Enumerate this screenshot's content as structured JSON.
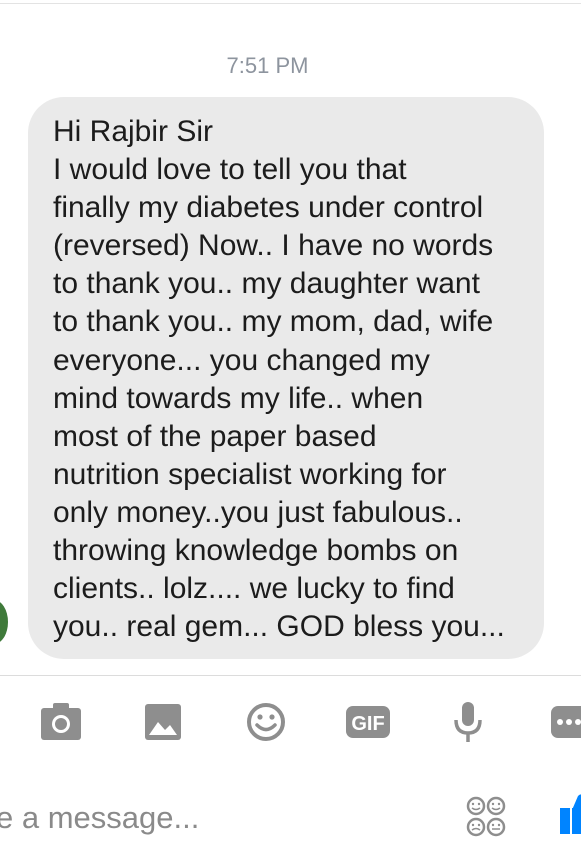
{
  "thread": {
    "timestamp": "7:51 PM",
    "message": {
      "lines": [
        "Hi Rajbir Sir",
        "I would love to tell you that",
        "finally my diabetes under control",
        "(reversed) Now.. I have no words",
        "to thank you.. my daughter want",
        "to thank you.. my mom, dad, wife",
        "everyone... you changed my",
        "mind towards my life.. when",
        "most of the paper based",
        "nutrition specialist working for",
        "only money..you just fabulous..",
        "throwing knowledge bombs on",
        "clients.. lolz.... we lucky to find",
        "you.. real gem... GOD bless you..."
      ]
    }
  },
  "toolbar": {
    "icons": [
      "camera-icon",
      "image-icon",
      "emoji-icon",
      "gif-icon",
      "microphone-icon",
      "more-icon"
    ],
    "gif_label": "GIF"
  },
  "composer": {
    "placeholder": "e a message..."
  },
  "colors": {
    "bubble": "#eaeaea",
    "icon_gray": "#8e8e8e",
    "messenger_blue": "#0084ff",
    "text": "#1c1c1c"
  }
}
